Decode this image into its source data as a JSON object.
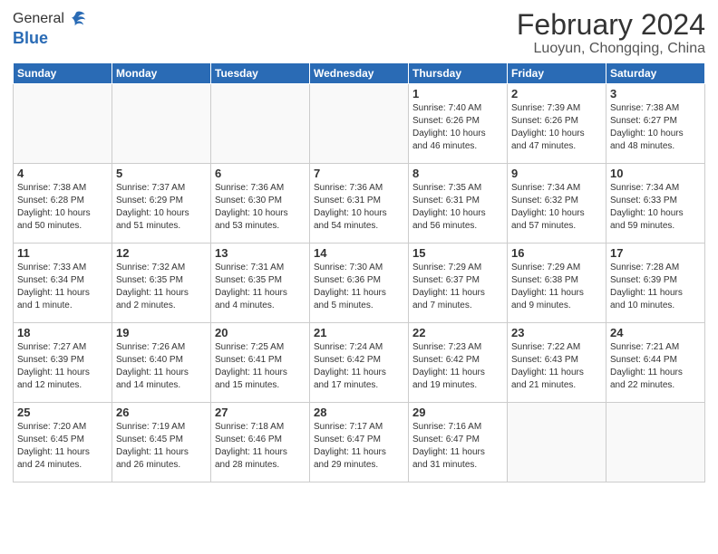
{
  "header": {
    "logo_general": "General",
    "logo_blue": "Blue",
    "month_title": "February 2024",
    "location": "Luoyun, Chongqing, China"
  },
  "weekdays": [
    "Sunday",
    "Monday",
    "Tuesday",
    "Wednesday",
    "Thursday",
    "Friday",
    "Saturday"
  ],
  "weeks": [
    [
      {
        "day": "",
        "info": ""
      },
      {
        "day": "",
        "info": ""
      },
      {
        "day": "",
        "info": ""
      },
      {
        "day": "",
        "info": ""
      },
      {
        "day": "1",
        "info": "Sunrise: 7:40 AM\nSunset: 6:26 PM\nDaylight: 10 hours\nand 46 minutes."
      },
      {
        "day": "2",
        "info": "Sunrise: 7:39 AM\nSunset: 6:26 PM\nDaylight: 10 hours\nand 47 minutes."
      },
      {
        "day": "3",
        "info": "Sunrise: 7:38 AM\nSunset: 6:27 PM\nDaylight: 10 hours\nand 48 minutes."
      }
    ],
    [
      {
        "day": "4",
        "info": "Sunrise: 7:38 AM\nSunset: 6:28 PM\nDaylight: 10 hours\nand 50 minutes."
      },
      {
        "day": "5",
        "info": "Sunrise: 7:37 AM\nSunset: 6:29 PM\nDaylight: 10 hours\nand 51 minutes."
      },
      {
        "day": "6",
        "info": "Sunrise: 7:36 AM\nSunset: 6:30 PM\nDaylight: 10 hours\nand 53 minutes."
      },
      {
        "day": "7",
        "info": "Sunrise: 7:36 AM\nSunset: 6:31 PM\nDaylight: 10 hours\nand 54 minutes."
      },
      {
        "day": "8",
        "info": "Sunrise: 7:35 AM\nSunset: 6:31 PM\nDaylight: 10 hours\nand 56 minutes."
      },
      {
        "day": "9",
        "info": "Sunrise: 7:34 AM\nSunset: 6:32 PM\nDaylight: 10 hours\nand 57 minutes."
      },
      {
        "day": "10",
        "info": "Sunrise: 7:34 AM\nSunset: 6:33 PM\nDaylight: 10 hours\nand 59 minutes."
      }
    ],
    [
      {
        "day": "11",
        "info": "Sunrise: 7:33 AM\nSunset: 6:34 PM\nDaylight: 11 hours\nand 1 minute."
      },
      {
        "day": "12",
        "info": "Sunrise: 7:32 AM\nSunset: 6:35 PM\nDaylight: 11 hours\nand 2 minutes."
      },
      {
        "day": "13",
        "info": "Sunrise: 7:31 AM\nSunset: 6:35 PM\nDaylight: 11 hours\nand 4 minutes."
      },
      {
        "day": "14",
        "info": "Sunrise: 7:30 AM\nSunset: 6:36 PM\nDaylight: 11 hours\nand 5 minutes."
      },
      {
        "day": "15",
        "info": "Sunrise: 7:29 AM\nSunset: 6:37 PM\nDaylight: 11 hours\nand 7 minutes."
      },
      {
        "day": "16",
        "info": "Sunrise: 7:29 AM\nSunset: 6:38 PM\nDaylight: 11 hours\nand 9 minutes."
      },
      {
        "day": "17",
        "info": "Sunrise: 7:28 AM\nSunset: 6:39 PM\nDaylight: 11 hours\nand 10 minutes."
      }
    ],
    [
      {
        "day": "18",
        "info": "Sunrise: 7:27 AM\nSunset: 6:39 PM\nDaylight: 11 hours\nand 12 minutes."
      },
      {
        "day": "19",
        "info": "Sunrise: 7:26 AM\nSunset: 6:40 PM\nDaylight: 11 hours\nand 14 minutes."
      },
      {
        "day": "20",
        "info": "Sunrise: 7:25 AM\nSunset: 6:41 PM\nDaylight: 11 hours\nand 15 minutes."
      },
      {
        "day": "21",
        "info": "Sunrise: 7:24 AM\nSunset: 6:42 PM\nDaylight: 11 hours\nand 17 minutes."
      },
      {
        "day": "22",
        "info": "Sunrise: 7:23 AM\nSunset: 6:42 PM\nDaylight: 11 hours\nand 19 minutes."
      },
      {
        "day": "23",
        "info": "Sunrise: 7:22 AM\nSunset: 6:43 PM\nDaylight: 11 hours\nand 21 minutes."
      },
      {
        "day": "24",
        "info": "Sunrise: 7:21 AM\nSunset: 6:44 PM\nDaylight: 11 hours\nand 22 minutes."
      }
    ],
    [
      {
        "day": "25",
        "info": "Sunrise: 7:20 AM\nSunset: 6:45 PM\nDaylight: 11 hours\nand 24 minutes."
      },
      {
        "day": "26",
        "info": "Sunrise: 7:19 AM\nSunset: 6:45 PM\nDaylight: 11 hours\nand 26 minutes."
      },
      {
        "day": "27",
        "info": "Sunrise: 7:18 AM\nSunset: 6:46 PM\nDaylight: 11 hours\nand 28 minutes."
      },
      {
        "day": "28",
        "info": "Sunrise: 7:17 AM\nSunset: 6:47 PM\nDaylight: 11 hours\nand 29 minutes."
      },
      {
        "day": "29",
        "info": "Sunrise: 7:16 AM\nSunset: 6:47 PM\nDaylight: 11 hours\nand 31 minutes."
      },
      {
        "day": "",
        "info": ""
      },
      {
        "day": "",
        "info": ""
      }
    ]
  ]
}
